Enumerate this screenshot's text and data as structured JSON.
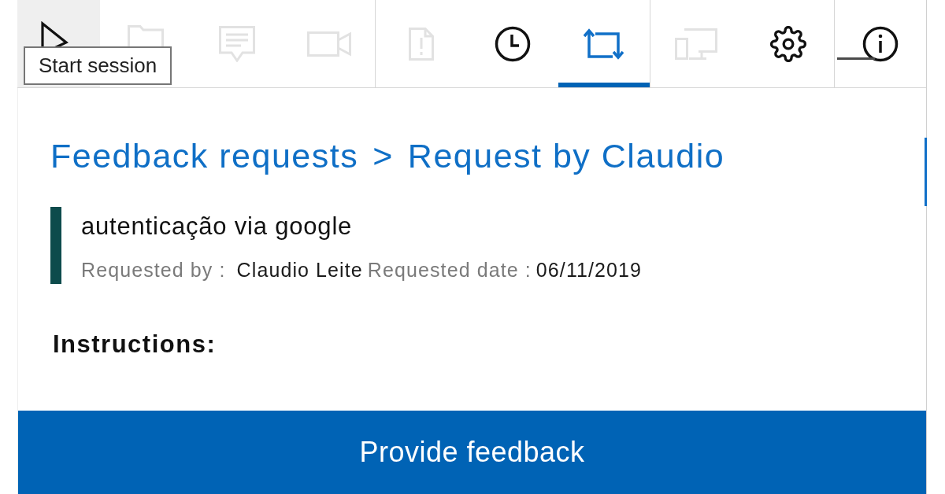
{
  "toolbar": {
    "groups": [
      {
        "tools": [
          {
            "hovered": true,
            "disabled": false,
            "selected": false
          },
          {
            "hovered": false,
            "disabled": true,
            "selected": false
          },
          {
            "hovered": false,
            "disabled": true,
            "selected": false
          },
          {
            "hovered": false,
            "disabled": true,
            "selected": false
          }
        ]
      },
      {
        "tools": [
          {
            "hovered": false,
            "disabled": true,
            "selected": false
          },
          {
            "hovered": false,
            "disabled": false,
            "selected": false
          },
          {
            "hovered": false,
            "disabled": false,
            "selected": true
          }
        ]
      },
      {
        "tools": [
          {
            "hovered": false,
            "disabled": true,
            "selected": false
          },
          {
            "hovered": false,
            "disabled": false,
            "selected": false
          }
        ]
      },
      {
        "tools": [
          {
            "hovered": false,
            "disabled": false,
            "selected": false
          }
        ]
      }
    ]
  },
  "tooltip": {
    "text": "Start session"
  },
  "breadcrumb": {
    "items": [
      {
        "label": "Feedback requests"
      },
      {
        "label": "Request by Claudio"
      }
    ],
    "separator": ">"
  },
  "request": {
    "title": "autenticação via google",
    "requested_by_label": "Requested by :",
    "requested_by": "Claudio Leite",
    "requested_date_label": "Requested date :",
    "requested_date": "06/11/2019"
  },
  "instructions_heading": "Instructions:",
  "primary_button": {
    "label": "Provide feedback"
  }
}
